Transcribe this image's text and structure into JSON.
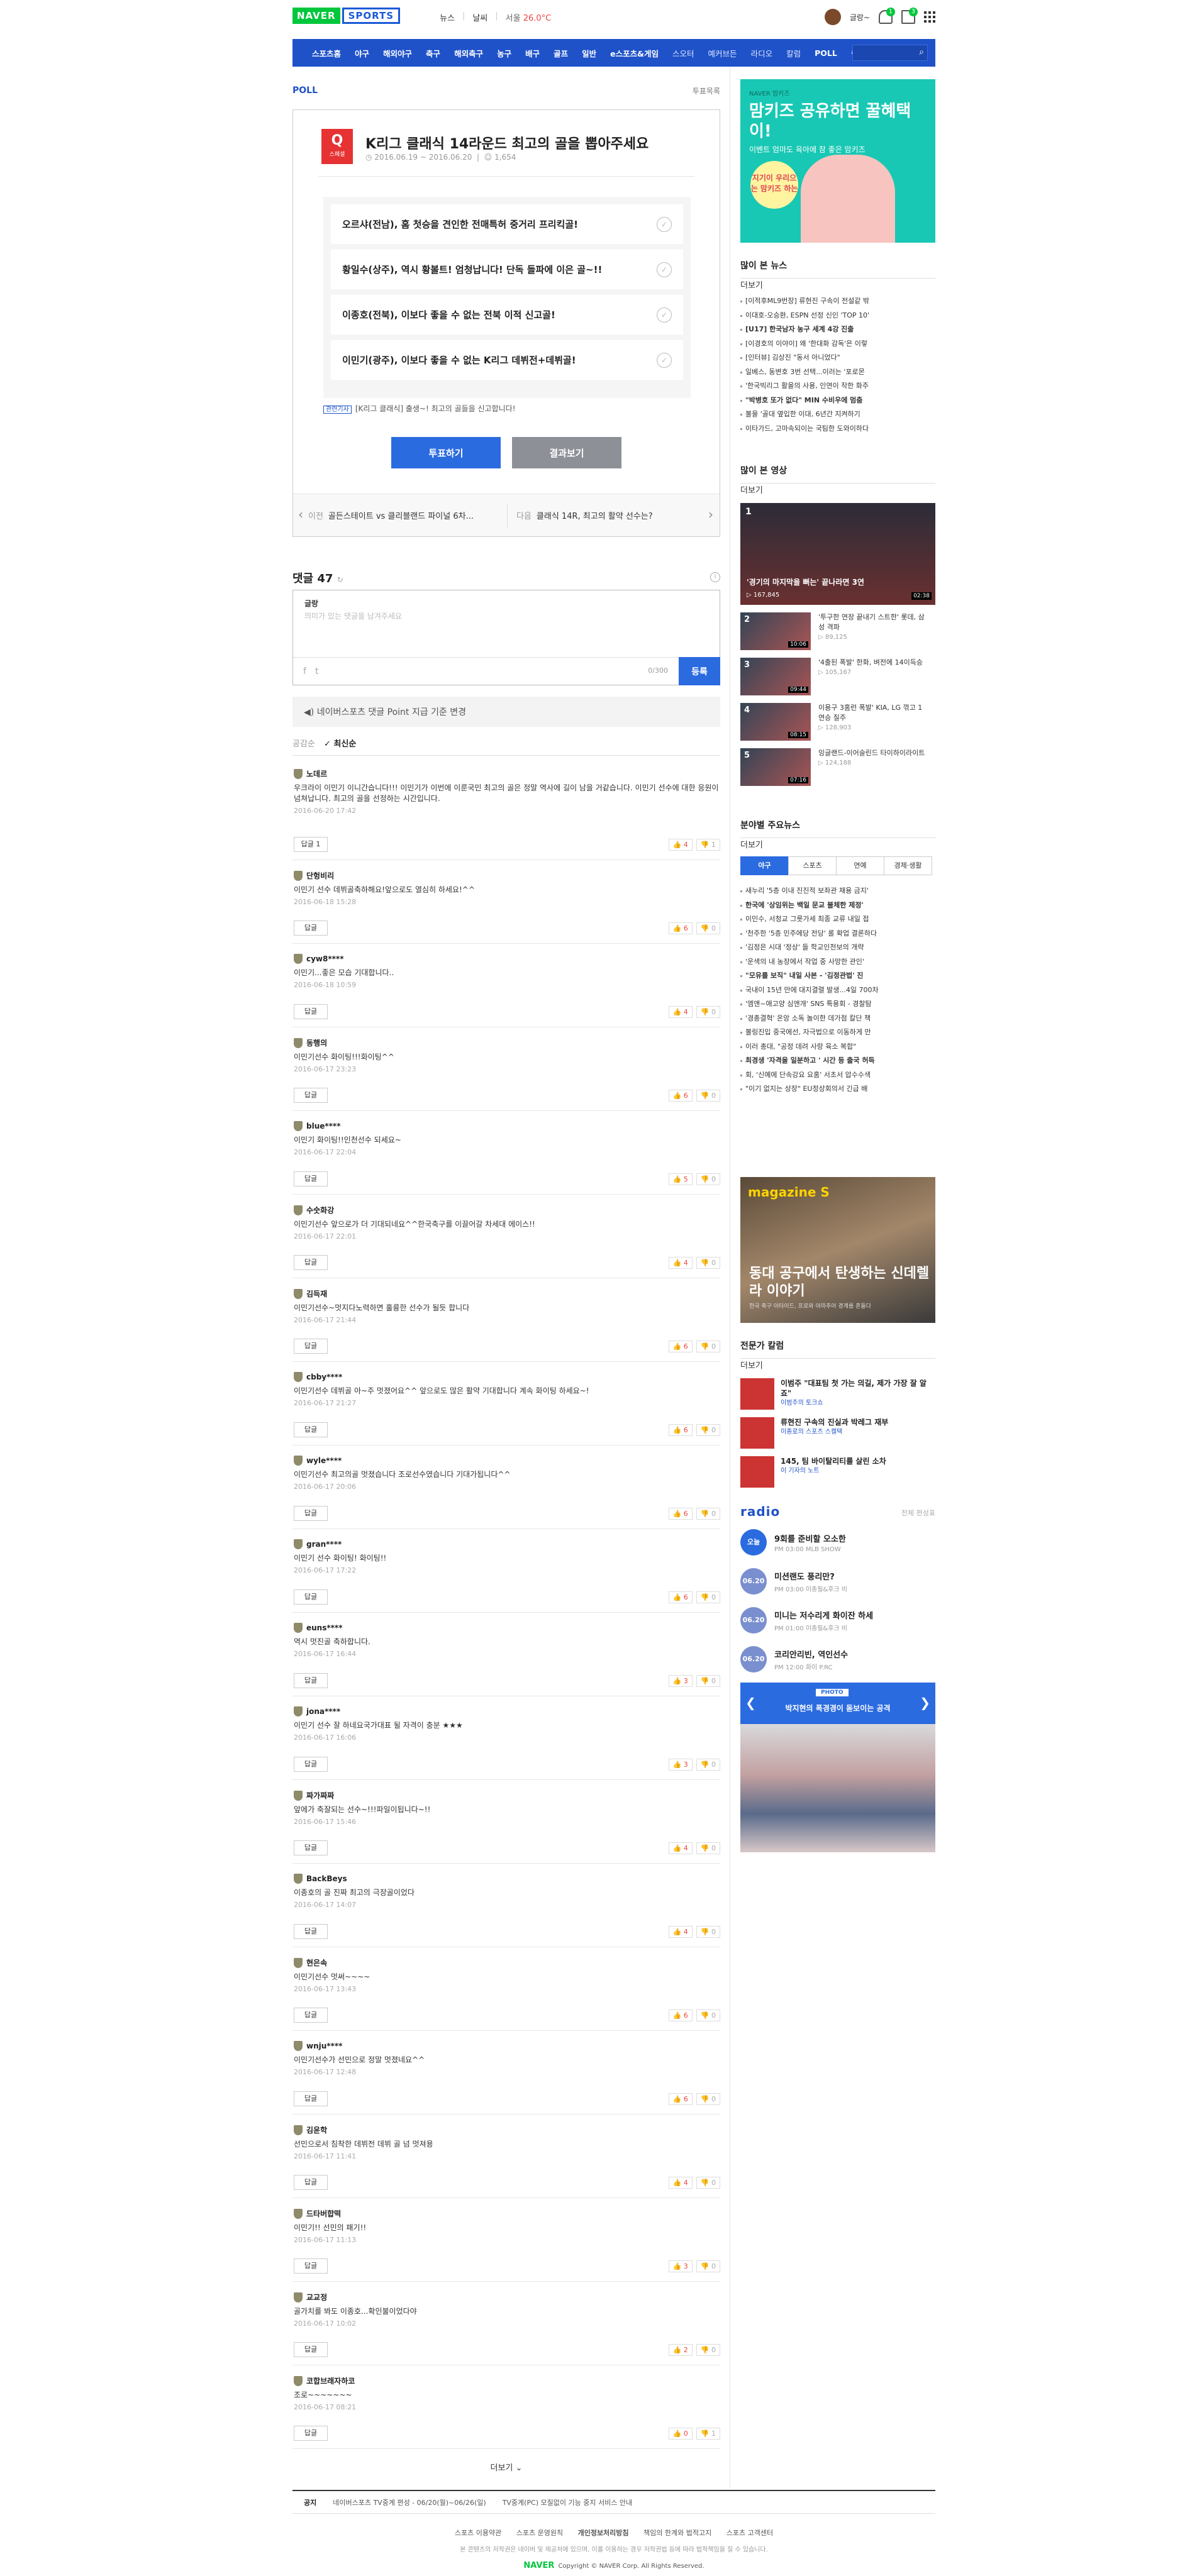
{
  "gnb": {
    "logo_naver": "NAVER",
    "logo_sports": "SPORTS",
    "menu": [
      "뉴스",
      "날씨"
    ],
    "weather": "서울",
    "temp": "26.0°C",
    "user": "글랑~",
    "badge1": "1",
    "badge2": "3"
  },
  "nav": [
    "스포츠홈",
    "야구",
    "해외야구",
    "축구",
    "해외축구",
    "농구",
    "배구",
    "골프",
    "일반",
    "e스포츠&게임",
    "스오터",
    "예커브든",
    "라디오",
    "칼럼",
    "POLL",
    "랭킹"
  ],
  "poll": {
    "section": "POLL",
    "list_link": "투표목록",
    "icon": "Q",
    "icon_sub": "스페셜",
    "title": "K리그 클래식 14라운드 최고의 골을 뽑아주세요",
    "period": "2016.06.19 ~ 2016.06.20",
    "count": "1,654",
    "options": [
      "오르샤(전남), 홈 첫승을 견인한 전매특허 중거리 프리킥골!",
      "황일수(상주), 역시 황볼트! 엄청납니다! 단독 돌파에 이은 골~!!",
      "이종호(전북), 이보다 좋을 수 없는 전북 이적 신고골!",
      "이민기(광주), 이보다 좋을 수 없는 K리그 데뷔전+데뷔골!"
    ],
    "related_tag": "관련기사",
    "related": "[K리그 클래식] 출생~! 최고의 골들을 신고합니다!",
    "vote": "투표하기",
    "result": "결과보기",
    "prev_lbl": "이전",
    "prev": "골든스테이트 vs 클리블랜드 파이널 6차...",
    "next_lbl": "다음",
    "next": "클래식 14R, 최고의 활약 선수는?"
  },
  "comments": {
    "header": "댓글 47",
    "box_name": "글랑",
    "placeholder": "의미가 있는 댓글을 남겨주세요",
    "counter": "0/300",
    "register": "등록",
    "notice": "네이버스포츠 댓글 Point 지급 기준 변경",
    "sort_a": "공감순",
    "sort_b": "최신순",
    "reply": "답글",
    "more": "더보기",
    "items": [
      {
        "name": "노데르",
        "text": "우크라이 이민기 이니간습니다!!! 이민기가 이번에 이룬국민 최고의 골은 정말 역사에 길이 남을 거같습니다. 이민기 선수에 대한 응원이 넘쳐납니다. 최고의 골을 선정하는 시간입니다.",
        "date": "2016-06-20 17:42",
        "up": "4",
        "down": "1",
        "replies": "답글 1"
      },
      {
        "name": "단헝비리",
        "text": "이민기 선수 데뷔골축하해요!앞으로도 열심히 하세요!^^",
        "date": "2016-06-18 15:28",
        "up": "6",
        "down": "0",
        "replies": "답글"
      },
      {
        "name": "cyw8****",
        "text": "이민기...좋은 모습 기대합니다..",
        "date": "2016-06-18 10:59",
        "up": "4",
        "down": "0",
        "replies": "답글"
      },
      {
        "name": "동행의",
        "text": "이민기선수 화이팅!!!화이팅^^",
        "date": "2016-06-17 23:23",
        "up": "6",
        "down": "0",
        "replies": "답글"
      },
      {
        "name": "blue****",
        "text": "이민기 화이팅!!인천선수 되세요~",
        "date": "2016-06-17 22:04",
        "up": "5",
        "down": "0",
        "replies": "답글"
      },
      {
        "name": "수숫화강",
        "text": "이민기선수 앞으로가 더 기대되네요^^한국축구를 이끌어갈 차세대 에이스!!",
        "date": "2016-06-17 22:01",
        "up": "4",
        "down": "0",
        "replies": "답글"
      },
      {
        "name": "김득재",
        "text": "이민기선수~멋지다노력하면 훌륭한 선수가 될듯 합니다",
        "date": "2016-06-17 21:44",
        "up": "6",
        "down": "0",
        "replies": "답글"
      },
      {
        "name": "cbby****",
        "text": "이민기선수 데뷔골 아~주 멋졌어요^^ 앞으로도 많은 활약 기대합니다 계속 화이팅 하세요~!",
        "date": "2016-06-17 21:27",
        "up": "6",
        "down": "0",
        "replies": "답글"
      },
      {
        "name": "wyle****",
        "text": "이민기선수 최고의골 멋졌습니다 조로선수였습니다 기대가됩니다^^",
        "date": "2016-06-17 20:06",
        "up": "6",
        "down": "0",
        "replies": "답글"
      },
      {
        "name": "gran****",
        "text": "이민기 선수 화이팅! 화이팅!!",
        "date": "2016-06-17 17:22",
        "up": "6",
        "down": "0",
        "replies": "답글"
      },
      {
        "name": "euns****",
        "text": "역시 멋진골 축하합니다.",
        "date": "2016-06-17 16:44",
        "up": "3",
        "down": "0",
        "replies": "답글"
      },
      {
        "name": "jona****",
        "text": "이민기 선수 잘 하네요국가대표 될 자격이 충분 ★★★",
        "date": "2016-06-17 16:06",
        "up": "3",
        "down": "0",
        "replies": "답글"
      },
      {
        "name": "짜가짜짜",
        "text": "앞에가 축잘되는 선수~!!!파일이됩니다~!!",
        "date": "2016-06-17 15:46",
        "up": "4",
        "down": "0",
        "replies": "답글"
      },
      {
        "name": "BackBeys",
        "text": "이종호의 골 진짜 최고의 극장골이었다",
        "date": "2016-06-17 14:07",
        "up": "4",
        "down": "0",
        "replies": "답글"
      },
      {
        "name": "현은속",
        "text": "이민기선수 멋써~~~~",
        "date": "2016-06-17 13:43",
        "up": "6",
        "down": "0",
        "replies": "답글"
      },
      {
        "name": "wnju****",
        "text": "이민기선수가 선민으로 정말 멋졌네요^^",
        "date": "2016-06-17 12:48",
        "up": "6",
        "down": "0",
        "replies": "답글"
      },
      {
        "name": "김윤학",
        "text": "선민으로서 침착한 데뷔전 데뷔 골 넘 멋져용",
        "date": "2016-06-17 11:41",
        "up": "4",
        "down": "0",
        "replies": "답글"
      },
      {
        "name": "드타버합떡",
        "text": "이민기!! 선민의 패기!!",
        "date": "2016-06-17 11:13",
        "up": "3",
        "down": "0",
        "replies": "답글"
      },
      {
        "name": "교교정",
        "text": "골가치를 봐도 이종호...확인불이었다야",
        "date": "2016-06-17 10:02",
        "up": "2",
        "down": "0",
        "replies": "답글"
      },
      {
        "name": "코합브래자하코",
        "text": "조로~~~~~~~",
        "date": "2016-06-17 08:21",
        "up": "0",
        "down": "1",
        "replies": "답글"
      }
    ]
  },
  "right": {
    "ad1": {
      "small": "NAVER 맘키즈",
      "h": "맘키즈 공유하면 꿀혜택이!",
      "sub": "이벤트 엄마도 육아에 참 좋은 맘키즈",
      "badge": "지기이 우리으는 맘키즈 하는"
    },
    "news_title": "많이 본 뉴스",
    "more": "더보기",
    "news": [
      "[이적후ML9번장] 류현진 구속이 전설같 밖",
      "이대호-오승환, ESPN 선정 신인 'TOP 10'",
      "[U17] 한국남자 농구 세계 4강 진출",
      "[이경호의 이야이] 왜 '한대화 감독'은 이렇",
      "[인터뷰] 김상진 \"동서 아니었다\"",
      "일베스, 동변호 3번 선택...이러는 '포로몬",
      "'한국빅리그 활을의 사용, 인연이 작한 화주",
      "\"박병호 또가 없다\" MIN 수비우에 멈춤",
      "볼을 '골대 옆입한 이대, 6년간 지켜하기",
      "이타가드, 고마속되이는 국팀한 도와이하다"
    ],
    "video_title": "많이 본 영상",
    "videos": [
      {
        "t": "'경기의 마지막을 뻐는' 끝나라면 3연",
        "c": "167,845",
        "d": "02:38"
      },
      {
        "t": "'투구한 연장 끝내기 스트한' 롯데, 삼성 격파",
        "c": "89,125",
        "d": "10:06"
      },
      {
        "t": "'4출된 폭발' 한화, 벼전에 14이득승",
        "c": "105,167",
        "d": "09:44"
      },
      {
        "t": "이용구 3홈런 폭발' KIA, LG 꺾고 1연승 질주",
        "c": "128,903",
        "d": "08:15"
      },
      {
        "t": "잉글랜드-이어슬린드 타이하이라이트",
        "c": "124,188",
        "d": "07:16"
      }
    ],
    "sports_news_title": "분야별 주요뉴스",
    "tabs": [
      "야구",
      "스포츠",
      "연예",
      "경제·생활"
    ],
    "sports_news": [
      "새누리 '5층 이내 진진적 보좌관 채용 금지'",
      "한국에 '상임위는 백일 문교 불체한 제정'",
      "이민수, 서청교 그릇가세 최종 교류 내일 접",
      "'천주한 '5층 민주에당 전당' 롤 확업 결론하다",
      "'김정은 시대 '정상' 들 학교인천보의 개략",
      "'운색의 내 농장에서 작업 중 사망한 관인'",
      "\"모유를 보직\" 내일 사본 - '김정관법' 진",
      "국내이 15년 만에 대지결렬 발생...4일 700차",
      "'엠앤~애고양 심앤개' SNS 특용회 - 경찰탐",
      "'경총결혁' 온앙 소독 놀이한 데가점 칼단 책",
      "볼링진입 중국에선, 자극법으로 이동하게 만",
      "이러 총대, \"공정 데려 사랑 육소 복합\"",
      "최경생 '자격을 일분하고 ' 시간 등 출국 허득",
      "회, '신예에 단속강요 요홈' 서초서 압수수색",
      "\"이기 없지는 상장\" EU정상회의서 긴급 배"
    ],
    "ad2": {
      "mg": "magazine S",
      "h": "동대 공구에서 탄생하는 신데렐라 이야기",
      "s": "한국 축구 아타이드, 프로와 아마추어 경계를 흔들다"
    },
    "column_title": "전문가 칼럼",
    "columns": [
      {
        "t": "이범주 \"대표팀 첫 가는 의길, 제가 가장 잘 알죠\"",
        "s": "이범주의 토크쇼"
      },
      {
        "t": "류현진 구속의 진실과 박레그 재부",
        "s": "이종로의 스포츠 스켈텍"
      },
      {
        "t": "145, 팀 바이탈리티를 살린 소차",
        "s": "이 기자의 노트"
      }
    ],
    "radio_title": "radio",
    "radio_more": "전체 편성표",
    "radio": [
      {
        "cc": "오늘",
        "t": "9회를 준비할 오소한",
        "s": "PM 03:00  MLB SHOW"
      },
      {
        "cc": "06.20",
        "t": "미션랜도 풍리만?",
        "s": "PM 03:00  이종필&후크 비"
      },
      {
        "cc": "06.20",
        "t": "미니는 저수리게 화이잔 하세",
        "s": "PM 01:00  이종필&후크 비"
      },
      {
        "cc": "06.20",
        "t": "코리안리빈, 역인선수",
        "s": "PM 12:00  화이 P.RC"
      }
    ],
    "photo_tag": "PHOTO",
    "photo_t": "박지현의 폭경경이 돋보이는 공격"
  },
  "footer": {
    "notice_lbl": "공지",
    "notices": [
      "네이버스포츠 TV중계 편성 - 06/20(월)~06/26(일)",
      "TV중계(PC) 모질없이 기능 중지 서비스 안내"
    ],
    "links": [
      "스포츠 이용약관",
      "스포츠 운영원칙",
      "개인정보처리방침",
      "책임의 한계와 법적고지",
      "스포츠 고객센터"
    ],
    "desc": "본 콘텐츠의 저작권은 네이버 및 제공처에 있으며, 이를 이용하는 경우 저작권법 등에 따라 법적책임을 질 수 있습니다.",
    "copy": "Copyright © NAVER Corp. All Rights Reserved.",
    "logo": "NAVER"
  }
}
